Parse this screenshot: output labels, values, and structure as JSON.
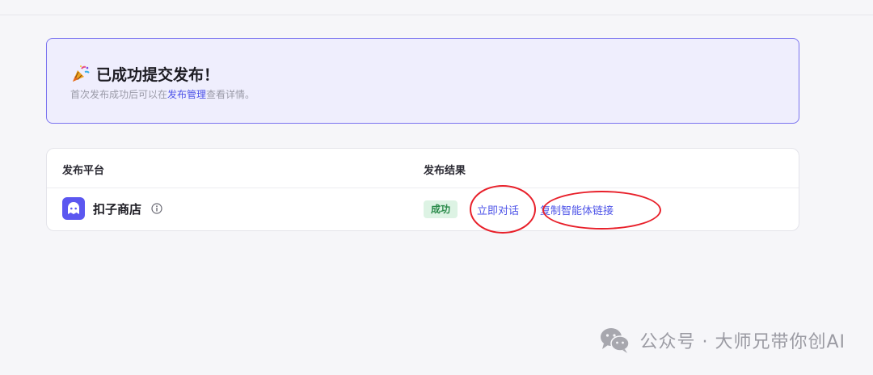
{
  "banner": {
    "title": "已成功提交发布！",
    "sub_prefix": "首次发布成功后可以在",
    "sub_link": "发布管理",
    "sub_suffix": "查看详情。"
  },
  "table": {
    "headers": {
      "platform": "发布平台",
      "result": "发布结果"
    },
    "rows": [
      {
        "platform": "扣子商店",
        "status": "成功",
        "chat_action": "立即对话",
        "copy_action": "复制智能体链接"
      }
    ]
  },
  "watermark": {
    "text": "公众号 · 大师兄带你创AI"
  },
  "colors": {
    "accent": "#4d53e8",
    "success_bg": "#ddf3e4",
    "success_fg": "#2a8a4a",
    "annotation": "#e8202a"
  }
}
